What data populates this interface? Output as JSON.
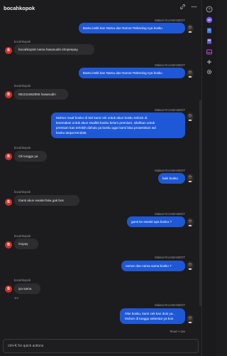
{
  "header": {
    "title": "bocahkopok"
  },
  "messages": [
    {
      "sender": "Malani RAJABANDOT",
      "text": "Bantu ketik kan Nama dan Nomor Rekening nya bosku"
    },
    {
      "sender": "bocahkopok",
      "text": "bocahkopok nama hasanudin shopeepay"
    },
    {
      "sender": "Malani RAJABANDOT",
      "text": "Bantu ketik kan Nama dan Nomor Rekening nya bosku"
    },
    {
      "sender": "bocahkopok",
      "text": "081211662855 hasanudin"
    },
    {
      "sender": "Malani RAJABANDOT",
      "lines": [
        "Mohon maaf bosku di sini kami cek untuk akun bosku terlock di",
        "karenakan untuk akun ewallet bosku belum premium, silahkan untuk",
        "premium kan terlebih dahulu ya bosku agar kami bisa prosesskan wd",
        "bosku tanpa kendala"
      ]
    },
    {
      "sender": "bocahkopok",
      "text": "Ok tunggu ya"
    },
    {
      "sender": "Malani RAJABANDOT",
      "text": "baik bosku"
    },
    {
      "sender": "bocahkopok",
      "text": "Ganti akun ewalet bisa gak bos"
    },
    {
      "sender": "Malani RAJABANDOT",
      "text": "ganti ke ewalet apa bosku ?"
    },
    {
      "sender": "bocahkopok",
      "text": "Gopay"
    },
    {
      "sender": "Malani RAJABANDOT",
      "text": "nomor dan nama sama bosku ?"
    },
    {
      "sender": "bocahkopok",
      "text": "iya sama",
      "time": "1m"
    },
    {
      "sender": "Malani RAJABANDOT",
      "lines": [
        "Oke bosku, kami cek kan dulu ya..",
        "Mohon di tunggu sebentar ya bos"
      ],
      "status": "Read • now"
    }
  ],
  "avatar_in_letter": "B",
  "input": {
    "placeholder": "ctrl+K for quick actions"
  },
  "colors": {
    "outgoing": "#1f58d6",
    "incoming": "#2d2d30",
    "avatar": "#d0322c"
  }
}
